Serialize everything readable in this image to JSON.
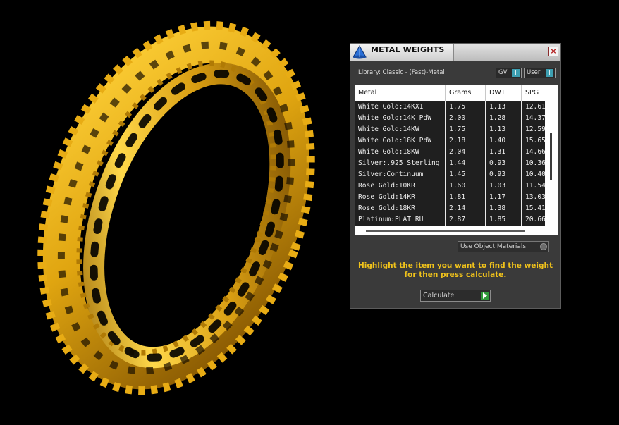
{
  "panel": {
    "title": "METAL WEIGHTS",
    "close_label": "×",
    "library_label": "Library: Classic - (Fast)-Metal",
    "gv_toggle": "GV",
    "user_toggle": "User",
    "toggle_knob": "I"
  },
  "table": {
    "columns": [
      "Metal",
      "Grams",
      "DWT",
      "SPG"
    ],
    "rows": [
      [
        "White Gold:14KX1",
        "1.75",
        "1.13",
        "12.61"
      ],
      [
        "White Gold:14K PdW",
        "2.00",
        "1.28",
        "14.37"
      ],
      [
        "White Gold:14KW",
        "1.75",
        "1.13",
        "12.59"
      ],
      [
        "White Gold:18K PdW",
        "2.18",
        "1.40",
        "15.65"
      ],
      [
        "White Gold:18KW",
        "2.04",
        "1.31",
        "14.66"
      ],
      [
        "Silver:.925 Sterling",
        "1.44",
        "0.93",
        "10.36"
      ],
      [
        "Silver:Continuum",
        "1.45",
        "0.93",
        "10.40"
      ],
      [
        "Rose Gold:10KR",
        "1.60",
        "1.03",
        "11.54"
      ],
      [
        "Rose Gold:14KR",
        "1.81",
        "1.17",
        "13.03"
      ],
      [
        "Rose Gold:18KR",
        "2.14",
        "1.38",
        "15.41"
      ],
      [
        "Platinum:PLAT RU",
        "2.87",
        "1.85",
        "20.66"
      ]
    ]
  },
  "use_object_materials": "Use Object Materials",
  "hint": {
    "line1": "Highlight the item you want to find the weight",
    "line2": "for then press calculate."
  },
  "calculate_label": "Calculate",
  "colors": {
    "background": "#000000",
    "ring_gold": "#e0a510",
    "hint_yellow": "#f0c21b",
    "panel_bg": "#3a3a3a",
    "row_bg": "#1f1f1f",
    "accent_teal": "#3d9fb1",
    "calculate_green": "#2f9a3a"
  },
  "icons": {
    "app": "cone-app-icon",
    "close": "close-icon",
    "calculate": "play-arrow-icon"
  }
}
